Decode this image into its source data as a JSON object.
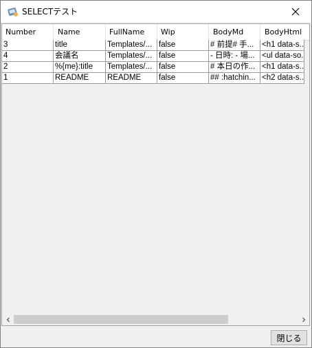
{
  "window": {
    "title": "SELECTテスト",
    "close_button_label": "閉じる"
  },
  "icons": {
    "app": "app-icon",
    "close": "close-icon",
    "scroll_left": "arrow-left-icon",
    "scroll_right": "arrow-right-icon"
  },
  "table": {
    "columns": [
      "Number",
      "Name",
      "FullName",
      "Wip",
      "BodyMd",
      "BodyHtml"
    ],
    "rows": [
      [
        "3",
        "title",
        "Templates/...",
        "false",
        "# 前提# 手...",
        "<h1 data-s..."
      ],
      [
        "4",
        "会議名",
        "Templates/...",
        "false",
        "- 日時: - 場...",
        "<ul data-so..."
      ],
      [
        "2",
        "%{me}:title",
        "Templates/...",
        "false",
        "# 本日の作...",
        "<h1 data-s..."
      ],
      [
        "1",
        "README",
        "README",
        "false",
        "##  :hatchin...",
        "<h2 data-s..."
      ]
    ]
  },
  "colors": {
    "window_bg": "#f0f0f0",
    "grid_bg": "#ffffff",
    "scroll_thumb": "#cdcdcd"
  }
}
